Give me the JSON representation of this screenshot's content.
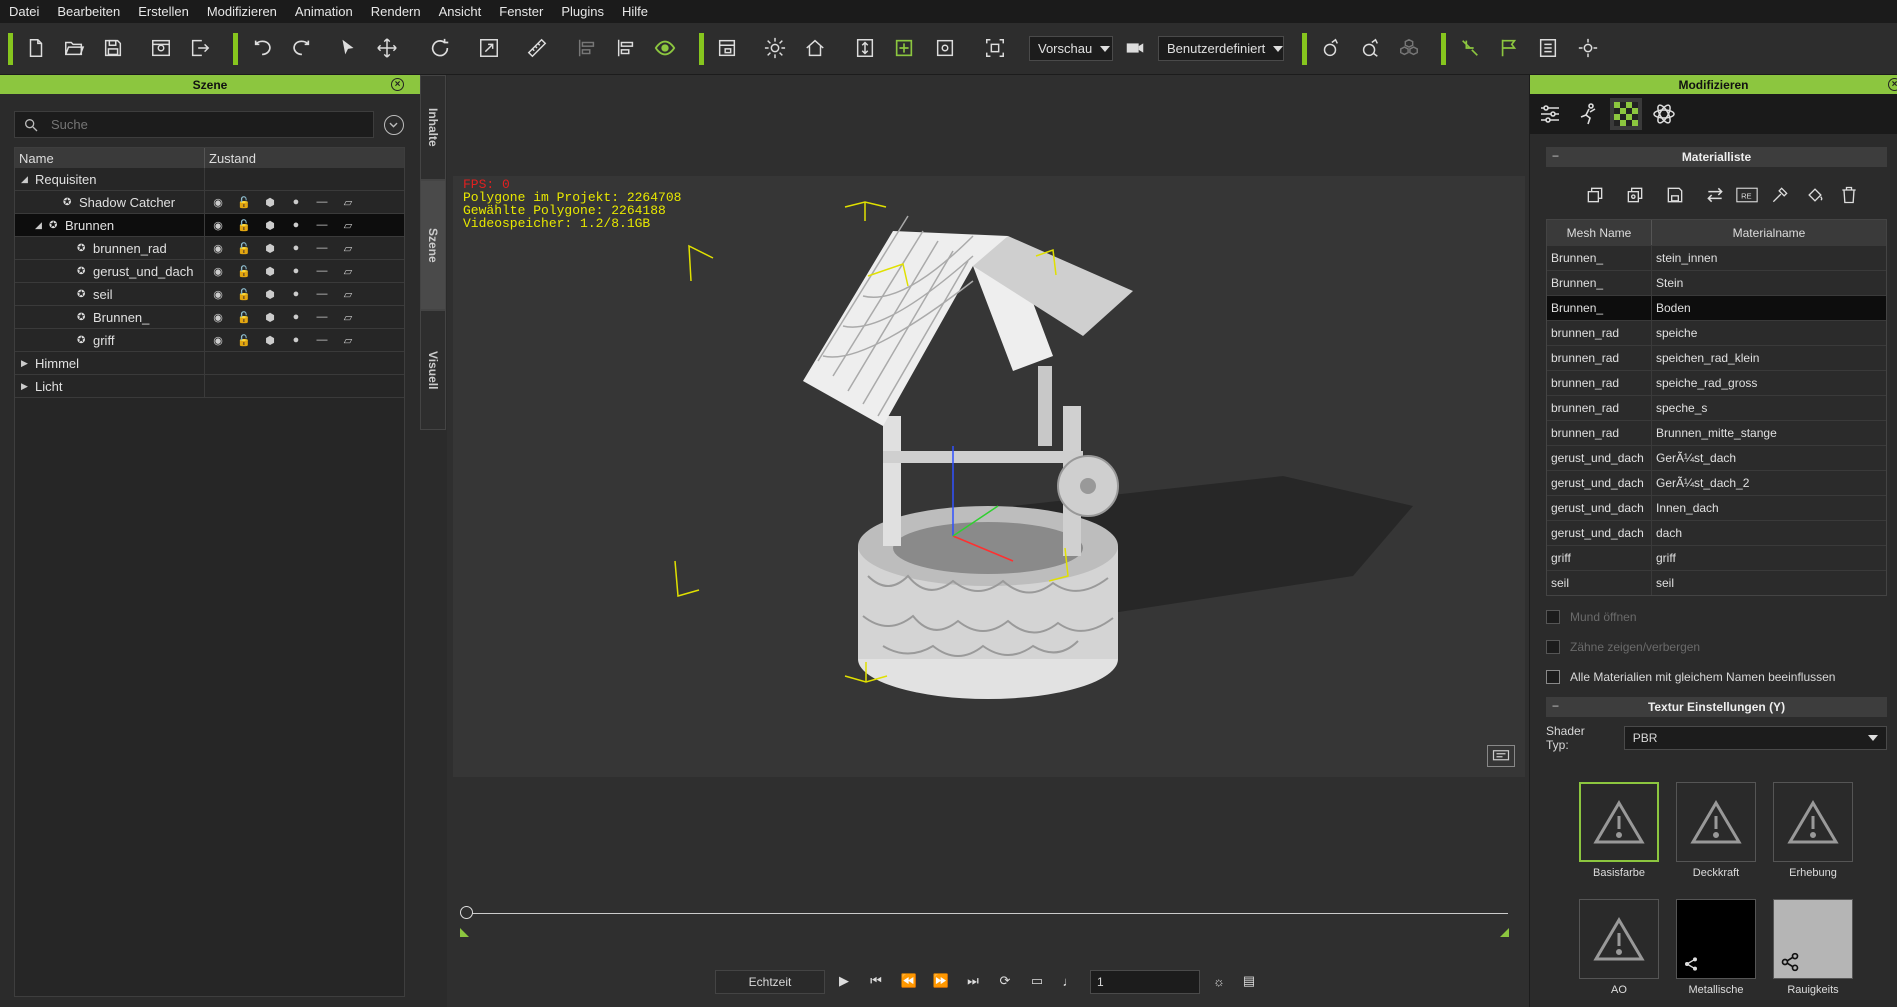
{
  "menu": [
    "Datei",
    "Bearbeiten",
    "Erstellen",
    "Modifizieren",
    "Animation",
    "Rendern",
    "Ansicht",
    "Fenster",
    "Plugins",
    "Hilfe"
  ],
  "toolbar": {
    "preview_label": "Vorschau",
    "custom_label": "Benutzerdefiniert"
  },
  "scene_panel": {
    "title": "Szene",
    "search_placeholder": "Suche",
    "col_name": "Name",
    "col_state": "Zustand",
    "items": [
      {
        "label": "Requisiten",
        "indent": 0,
        "expander": "open"
      },
      {
        "label": "Shadow Catcher",
        "indent": 2,
        "expander": "none"
      },
      {
        "label": "Brunnen",
        "indent": 1,
        "expander": "open",
        "selected": true
      },
      {
        "label": "brunnen_rad",
        "indent": 3,
        "expander": "none"
      },
      {
        "label": "gerust_und_dach",
        "indent": 3,
        "expander": "none"
      },
      {
        "label": "seil",
        "indent": 3,
        "expander": "none"
      },
      {
        "label": "Brunnen_",
        "indent": 3,
        "expander": "none"
      },
      {
        "label": "griff",
        "indent": 3,
        "expander": "none"
      },
      {
        "label": "Himmel",
        "indent": 0,
        "expander": "closed"
      },
      {
        "label": "Licht",
        "indent": 0,
        "expander": "closed"
      }
    ]
  },
  "side_tabs": [
    "Inhalte",
    "Szene",
    "Visuell"
  ],
  "viewport": {
    "fps": "FPS: 0",
    "poly_project": "Polygone im Projekt: 2264708",
    "poly_selected": "Gewählte Polygone: 2264188",
    "video_mem": "Videospeicher: 1.2/8.1GB"
  },
  "playback": {
    "mode_label": "Echtzeit",
    "frame_value": "1"
  },
  "modify_panel": {
    "title": "Modifizieren",
    "material_list_title": "Materialliste",
    "col_mesh": "Mesh Name",
    "col_material": "Materialname",
    "rows": [
      {
        "mesh": "Brunnen_",
        "material": "stein_innen"
      },
      {
        "mesh": "Brunnen_",
        "material": "Stein"
      },
      {
        "mesh": "Brunnen_",
        "material": "Boden",
        "selected": true
      },
      {
        "mesh": "brunnen_rad",
        "material": "speiche"
      },
      {
        "mesh": "brunnen_rad",
        "material": "speichen_rad_klein"
      },
      {
        "mesh": "brunnen_rad",
        "material": "speiche_rad_gross"
      },
      {
        "mesh": "brunnen_rad",
        "material": "speche_s"
      },
      {
        "mesh": "brunnen_rad",
        "material": "Brunnen_mitte_stange"
      },
      {
        "mesh": "gerust_und_dach",
        "material": "GerÃ¼st_dach"
      },
      {
        "mesh": "gerust_und_dach",
        "material": "GerÃ¼st_dach_2"
      },
      {
        "mesh": "gerust_und_dach",
        "material": "Innen_dach"
      },
      {
        "mesh": "gerust_und_dach",
        "material": "dach"
      },
      {
        "mesh": "griff",
        "material": "griff"
      },
      {
        "mesh": "seil",
        "material": "seil"
      }
    ],
    "cb_mouth": "Mund öffnen",
    "cb_teeth": "Zähne zeigen/verbergen",
    "cb_all_materials": "Alle Materialien mit gleichem Namen beeinflussen",
    "texture_title": "Textur Einstellungen (Y)",
    "shader_label": "Shader Typ:",
    "shader_value": "PBR",
    "textures": [
      "Basisfarbe",
      "Deckkraft",
      "Erhebung",
      "AO",
      "Metallische",
      "Rauigkeits"
    ]
  },
  "colors": {
    "accent": "#8cc63f",
    "fps": "#e02020",
    "stats": "#e8e800"
  }
}
